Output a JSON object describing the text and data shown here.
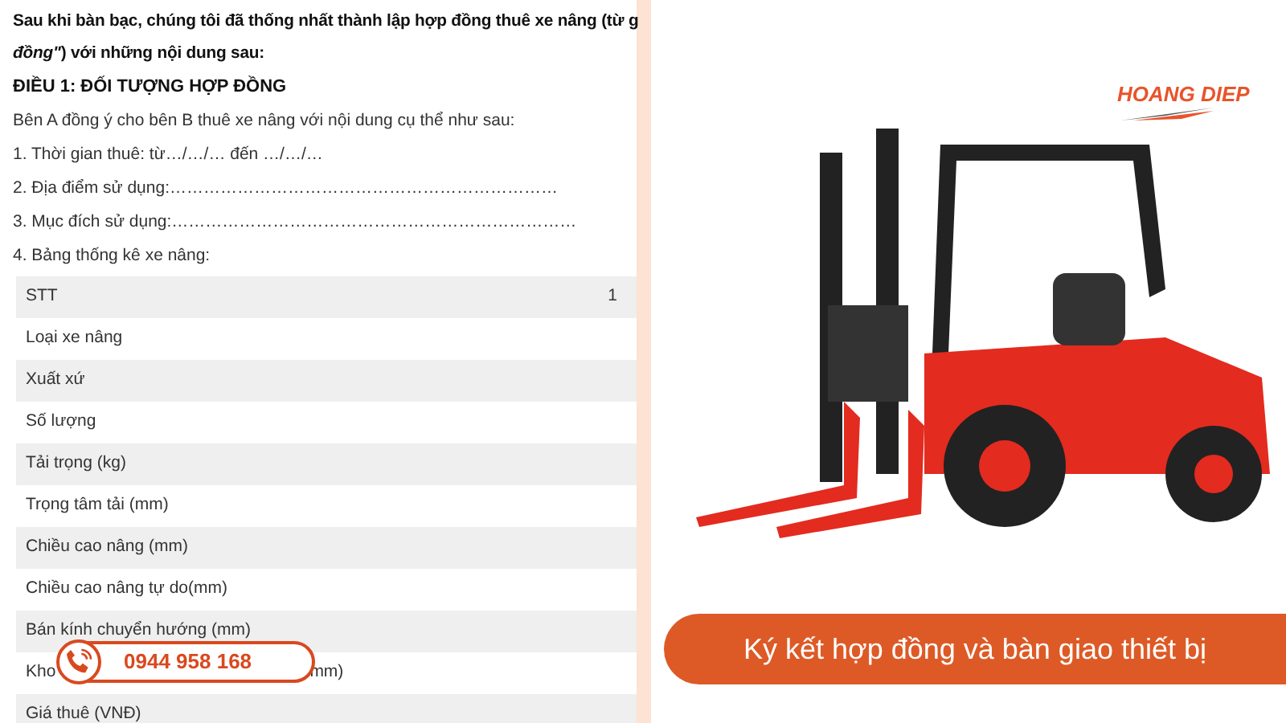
{
  "document": {
    "intro_lines": [
      "Sau khi bàn bạc, chúng tôi đã thống nhất thành lập hợp đồng thuê xe nâng (từ g",
      "*đồng\"*) với những nội dung sau:"
    ],
    "heading": "ĐIỀU 1: ĐỐI TƯỢNG HỢP ĐỒNG",
    "paragraphs": [
      "Bên A đồng ý cho bên B thuê xe nâng với nội dung cụ thể như sau:",
      "1. Thời gian thuê: từ…/…/… đến …/…/…",
      "2. Địa điểm sử dụng:……………………………………………………………",
      "3. Mục đích sử dụng:………………………………………………………………",
      "4. Bảng thống kê xe nâng:"
    ],
    "table": {
      "rows": [
        {
          "label": "STT",
          "value": "1"
        },
        {
          "label": "Loại xe nâng"
        },
        {
          "label": "Xuất xứ"
        },
        {
          "label": "Số lượng"
        },
        {
          "label": "Tải trọng (kg)"
        },
        {
          "label": "Trọng tâm tải (mm)"
        },
        {
          "label": "Chiều cao nâng (mm)"
        },
        {
          "label": "Chiều cao nâng tự do(mm)"
        },
        {
          "label": "Bán kính chuyển hướng (mm)"
        },
        {
          "label": "Kho",
          "label_end": "mm)"
        },
        {
          "label": "Giá thuê (VNĐ)"
        }
      ]
    }
  },
  "phone_badge": {
    "number": "0944 958 168"
  },
  "logo": {
    "text": "HOANG DIEP"
  },
  "caption": "Ký kết hợp đồng và bàn giao thiết bị"
}
